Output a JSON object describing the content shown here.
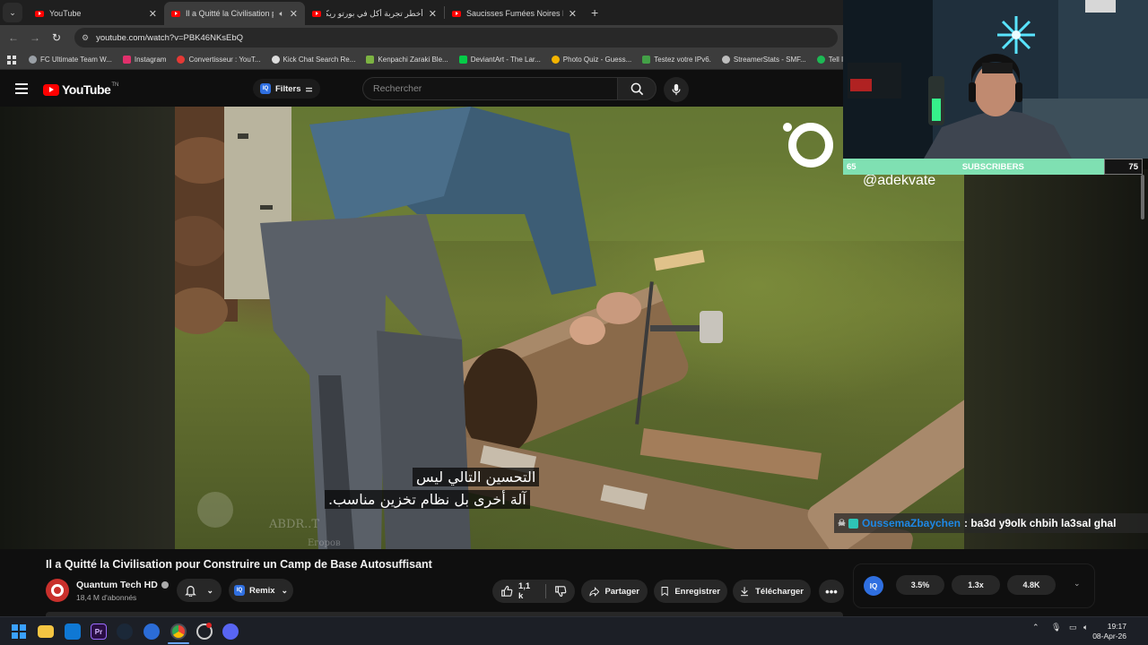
{
  "browser": {
    "tabs": [
      {
        "title": "YouTube",
        "active": false
      },
      {
        "title": "Il a Quitté la Civilisation po",
        "active": true,
        "audio": true
      },
      {
        "title": "أخطر تجربة أكل في بورتو ريكو..",
        "active": false
      },
      {
        "title": "Saucisses Fumées Noires Bushi",
        "active": false
      }
    ],
    "url": "youtube.com/watch?v=PBK46NKsEbQ",
    "bookmarks": [
      {
        "label": "FC Ultimate Team W...",
        "color": "#9aa0a6"
      },
      {
        "label": "Instagram",
        "color": "#e1306c"
      },
      {
        "label": "Convertisseur : YouT...",
        "color": "#e53935"
      },
      {
        "label": "Kick Chat Search Re...",
        "color": "#dddddd"
      },
      {
        "label": "Kenpachi Zaraki Ble...",
        "color": "#7cb342"
      },
      {
        "label": "DeviantArt - The Lar...",
        "color": "#05cc47"
      },
      {
        "label": "Photo Quiz - Guess...",
        "color": "#f4b400"
      },
      {
        "label": "Testez votre IPv6.",
        "color": "#43a047"
      },
      {
        "label": "StreamerStats - SMF...",
        "color": "#bdbdbd"
      },
      {
        "label": "Tell It",
        "color": "#1db954"
      }
    ]
  },
  "youtube": {
    "logo": "YouTube",
    "region": "TN",
    "filters_label": "Filters",
    "search_placeholder": "Rechercher"
  },
  "video": {
    "watermark_handle": "@adekvate",
    "caption_line1": "التحسين التالي ليس",
    "caption_line2": "آلة أخرى بل نظام تخزين مناسب.",
    "title": "Il a Quitté la Civilisation pour Construire un Camp de Base Autosuffisant",
    "channel_name": "Quantum Tech HD",
    "channel_subs": "18,4 M d'abonnés",
    "remix_label": "Remix",
    "likes": "1,1 k",
    "share_label": "Partager",
    "save_label": "Enregistrer",
    "download_label": "Télécharger",
    "stats": [
      "3.5%",
      "1.3x",
      "4.8K"
    ]
  },
  "stream": {
    "sub_current": "65",
    "sub_label": "SUBSCRIBERS",
    "sub_goal": "75",
    "sub_progress": 0.87,
    "chat_user": "OussemaZbaychen",
    "chat_message": ": ba3d y9olk chbih la3sal ghal"
  },
  "taskbar": {
    "time": "19:17",
    "date": "08-Apr-26"
  }
}
